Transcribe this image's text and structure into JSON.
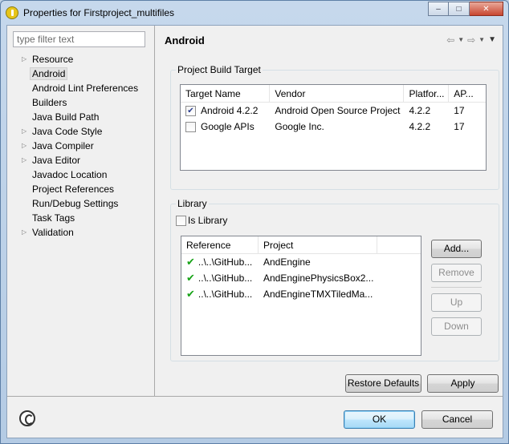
{
  "window": {
    "title": "Properties for Firstproject_multifiles",
    "controls": {
      "minimize": "–",
      "maximize": "□",
      "close": "✕"
    }
  },
  "sidebar": {
    "filter_placeholder": "type filter text",
    "items": [
      {
        "label": "Resource",
        "expandable": true,
        "selected": false
      },
      {
        "label": "Android",
        "expandable": false,
        "selected": true
      },
      {
        "label": "Android Lint Preferences",
        "expandable": false,
        "selected": false
      },
      {
        "label": "Builders",
        "expandable": false,
        "selected": false
      },
      {
        "label": "Java Build Path",
        "expandable": false,
        "selected": false
      },
      {
        "label": "Java Code Style",
        "expandable": true,
        "selected": false
      },
      {
        "label": "Java Compiler",
        "expandable": true,
        "selected": false
      },
      {
        "label": "Java Editor",
        "expandable": true,
        "selected": false
      },
      {
        "label": "Javadoc Location",
        "expandable": false,
        "selected": false
      },
      {
        "label": "Project References",
        "expandable": false,
        "selected": false
      },
      {
        "label": "Run/Debug Settings",
        "expandable": false,
        "selected": false
      },
      {
        "label": "Task Tags",
        "expandable": false,
        "selected": false
      },
      {
        "label": "Validation",
        "expandable": true,
        "selected": false
      }
    ]
  },
  "page": {
    "title": "Android",
    "nav_icons": [
      "back-arrow-icon",
      "dropdown-icon",
      "forward-arrow-icon",
      "dropdown-icon",
      "view-menu-icon"
    ]
  },
  "build_target": {
    "group_label": "Project Build Target",
    "columns": [
      "Target Name",
      "Vendor",
      "Platfor...",
      "AP..."
    ],
    "rows": [
      {
        "checked": true,
        "name": "Android 4.2.2",
        "vendor": "Android Open Source Project",
        "platform": "4.2.2",
        "api": "17"
      },
      {
        "checked": false,
        "name": "Google APIs",
        "vendor": "Google Inc.",
        "platform": "4.2.2",
        "api": "17"
      }
    ]
  },
  "library": {
    "group_label": "Library",
    "is_library_label": "Is Library",
    "is_library_checked": false,
    "columns": [
      "Reference",
      "Project"
    ],
    "rows": [
      {
        "reference": "..\\..\\GitHub...",
        "project": "AndEngine"
      },
      {
        "reference": "..\\..\\GitHub...",
        "project": "AndEnginePhysicsBox2..."
      },
      {
        "reference": "..\\..\\GitHub...",
        "project": "AndEngineTMXTiledMa..."
      }
    ],
    "buttons": {
      "add": "Add...",
      "remove": "Remove",
      "up": "Up",
      "down": "Down"
    }
  },
  "footer": {
    "restore_defaults": "Restore Defaults",
    "apply": "Apply",
    "ok": "OK",
    "cancel": "Cancel"
  },
  "colors": {
    "window_frame": "#bfd2e6",
    "dialog_bg": "#f0f0f0",
    "ok_highlight": "#3c7fb1",
    "check_green": "#17a317"
  }
}
